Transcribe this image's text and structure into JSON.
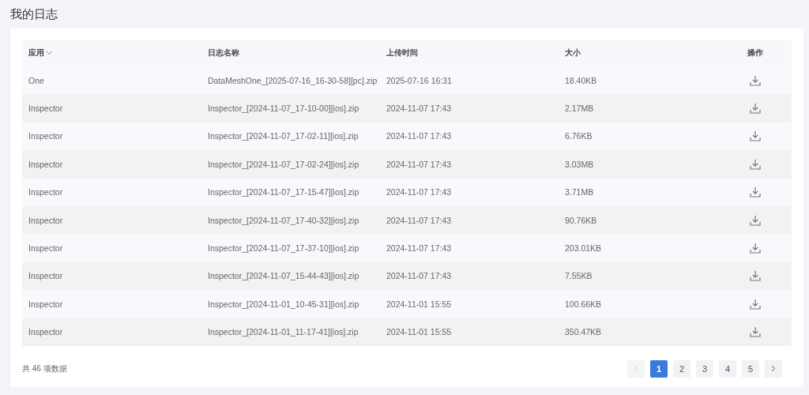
{
  "page_title": "我的日志",
  "table": {
    "columns": [
      {
        "label": "应用",
        "filter": true
      },
      {
        "label": "日志名称",
        "filter": false
      },
      {
        "label": "上传时间",
        "filter": false
      },
      {
        "label": "大小",
        "filter": false
      },
      {
        "label": "操作",
        "filter": false
      }
    ],
    "rows": [
      {
        "app": "One",
        "name": "DataMeshOne_[2025-07-16_16-30-58][pc].zip",
        "time": "2025-07-16 16:31",
        "size": "18.40KB"
      },
      {
        "app": "Inspector",
        "name": "Inspector_[2024-11-07_17-10-00][ios].zip",
        "time": "2024-11-07 17:43",
        "size": "2.17MB"
      },
      {
        "app": "Inspector",
        "name": "Inspector_[2024-11-07_17-02-11][ios].zip",
        "time": "2024-11-07 17:43",
        "size": "6.76KB"
      },
      {
        "app": "Inspector",
        "name": "Inspector_[2024-11-07_17-02-24][ios].zip",
        "time": "2024-11-07 17:43",
        "size": "3.03MB"
      },
      {
        "app": "Inspector",
        "name": "Inspector_[2024-11-07_17-15-47][ios].zip",
        "time": "2024-11-07 17:43",
        "size": "3.71MB"
      },
      {
        "app": "Inspector",
        "name": "Inspector_[2024-11-07_17-40-32][ios].zip",
        "time": "2024-11-07 17:43",
        "size": "90.76KB"
      },
      {
        "app": "Inspector",
        "name": "Inspector_[2024-11-07_17-37-10][ios].zip",
        "time": "2024-11-07 17:43",
        "size": "203.01KB"
      },
      {
        "app": "Inspector",
        "name": "Inspector_[2024-11-07_15-44-43][ios].zip",
        "time": "2024-11-07 17:43",
        "size": "7.55KB"
      },
      {
        "app": "Inspector",
        "name": "Inspector_[2024-11-01_10-45-31][ios].zip",
        "time": "2024-11-01 15:55",
        "size": "100.66KB"
      },
      {
        "app": "Inspector",
        "name": "Inspector_[2024-11-01_11-17-41][ios].zip",
        "time": "2024-11-01 15:55",
        "size": "350.47KB"
      }
    ]
  },
  "footer": {
    "total": "共 46 项数据"
  },
  "pagination": {
    "prev_disabled": true,
    "next_disabled": false,
    "pages": [
      {
        "label": "1",
        "selected": true
      },
      {
        "label": "2",
        "selected": false
      },
      {
        "label": "3",
        "selected": false
      },
      {
        "label": "4",
        "selected": false
      },
      {
        "label": "5",
        "selected": false
      }
    ]
  }
}
